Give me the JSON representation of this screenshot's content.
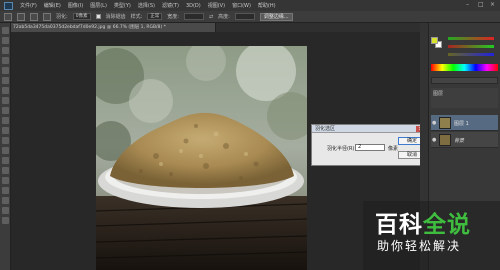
{
  "menubar": {
    "items": [
      "文件(F)",
      "编辑(E)",
      "图像(I)",
      "图层(L)",
      "类型(Y)",
      "选择(S)",
      "滤镜(T)",
      "3D(D)",
      "视图(V)",
      "窗口(W)",
      "帮助(H)"
    ]
  },
  "options": {
    "feather_label": "羽化:",
    "feather_value": "0像素",
    "antialias_label": "消除锯齿",
    "style_label": "样式:",
    "style_value": "正常",
    "width_label": "宽度:",
    "height_label": "高度:",
    "refine_button": "调整边缘..."
  },
  "document": {
    "tab_title": "72ab5da3475da0375d2ebdaf7d0e92.jpg @ 66.7% (图层 1, RGB/8) *"
  },
  "dialog": {
    "title": "羽化选区",
    "radius_label": "羽化半径(R):",
    "radius_value": "2",
    "unit": "像素",
    "ok_label": "确定",
    "cancel_label": "取消"
  },
  "panels": {
    "layers_tab": "图层",
    "layers": [
      {
        "name": "图层 1",
        "selected": true
      },
      {
        "name": "背景",
        "selected": false
      }
    ]
  },
  "colors": {
    "foreground": "#d7e32c",
    "background": "#ffffff",
    "accent_green": "#3fbd3f"
  },
  "watermark": {
    "title_part1": "百科",
    "title_part2": "全说",
    "subtitle": "助你轻松解决"
  }
}
